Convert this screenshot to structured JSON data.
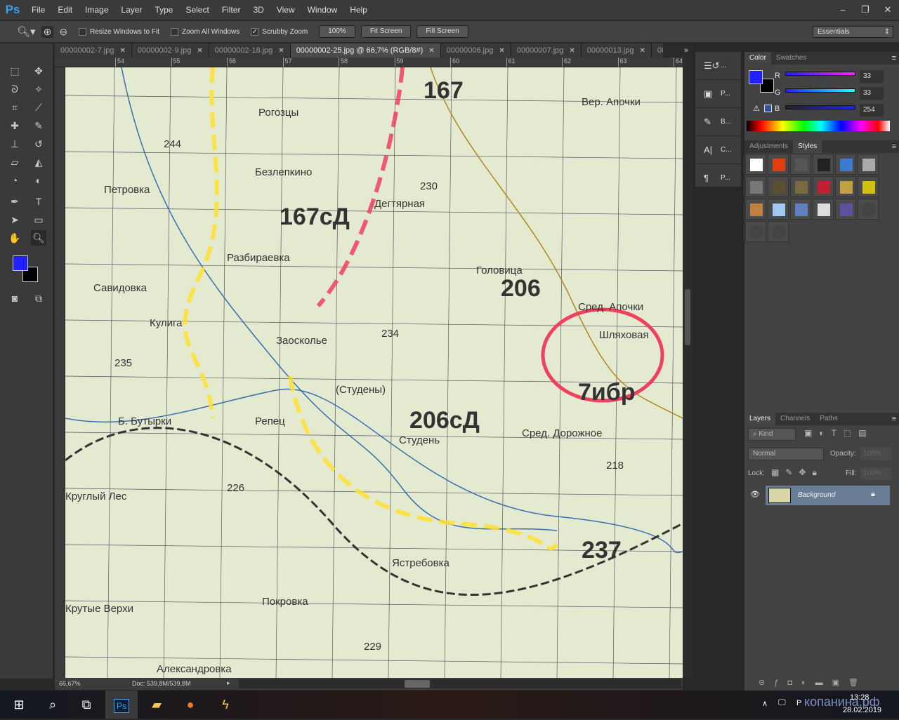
{
  "app": {
    "logo": "Ps",
    "menu": [
      "File",
      "Edit",
      "Image",
      "Layer",
      "Type",
      "Select",
      "Filter",
      "3D",
      "View",
      "Window",
      "Help"
    ]
  },
  "options": {
    "resize_windows": "Resize Windows to Fit",
    "resize_checked": false,
    "zoom_all": "Zoom All Windows",
    "zoom_all_checked": false,
    "scrubby": "Scrubby Zoom",
    "scrubby_checked": true,
    "btn_100": "100%",
    "fit_screen": "Fit Screen",
    "fill_screen": "Fill Screen",
    "workspace": "Essentials"
  },
  "tabs": [
    {
      "label": "00000002-7.jpg",
      "active": false
    },
    {
      "label": "00000002-9.jpg",
      "active": false
    },
    {
      "label": "00000002-18.jpg",
      "active": false
    },
    {
      "label": "00000002-25.jpg @ 66,7% (RGB/8#)",
      "active": true
    },
    {
      "label": "00000006.jpg",
      "active": false
    },
    {
      "label": "00000007.jpg",
      "active": false
    },
    {
      "label": "00000013.jpg",
      "active": false
    },
    {
      "label": "00",
      "active": false
    }
  ],
  "ruler_top": [
    "54",
    "55",
    "56",
    "57",
    "58",
    "59",
    "60",
    "61",
    "62",
    "63",
    "64"
  ],
  "map_labels": [
    "167",
    "Вер. Апочки",
    "Рогозцы",
    "Безлепкино",
    "244",
    "Петровка",
    "230",
    "Дегтярная",
    "167сД",
    "Разбираевка",
    "Головица",
    "206",
    "Савидовка",
    "Сред. Апочки",
    "Кулига",
    "Заосколье",
    "234",
    "Шляховая",
    "235",
    "(Студены)",
    "7ибр",
    "Б. Бутырки",
    "Репец",
    "206сД",
    "Студень",
    "Сред. Дорожное",
    "226",
    "Круглый Лес",
    "218",
    "237",
    "Ястребовка",
    "Крутые Верхи",
    "Покровка",
    "229",
    "Александровка"
  ],
  "status": {
    "zoom": "66,67%",
    "doc": "Doc: 539,8M/539,8M"
  },
  "dock": [
    {
      "label": "..."
    },
    {
      "label": "P..."
    },
    {
      "label": "B..."
    },
    {
      "label": "C..."
    },
    {
      "label": "P..."
    }
  ],
  "color_panel": {
    "tabs": [
      "Color",
      "Swatches"
    ],
    "fg": "#2121fe",
    "bg": "#000000",
    "r": "33",
    "g": "33",
    "b": "254"
  },
  "styles_panel": {
    "tabs": [
      "Adjustments",
      "Styles"
    ]
  },
  "layers_panel": {
    "tabs": [
      "Layers",
      "Channels",
      "Paths"
    ],
    "kind": "Kind",
    "blend": "Normal",
    "opacity_label": "Opacity:",
    "opacity": "100%",
    "lock_label": "Lock:",
    "fill_label": "Fill:",
    "fill": "100%",
    "layers": [
      {
        "name": "Background",
        "visible": true,
        "locked": true
      }
    ]
  },
  "taskbar": {
    "time": "13:28",
    "date": "28.02.2019",
    "lang": "Р"
  },
  "watermark": "копанина.рф"
}
